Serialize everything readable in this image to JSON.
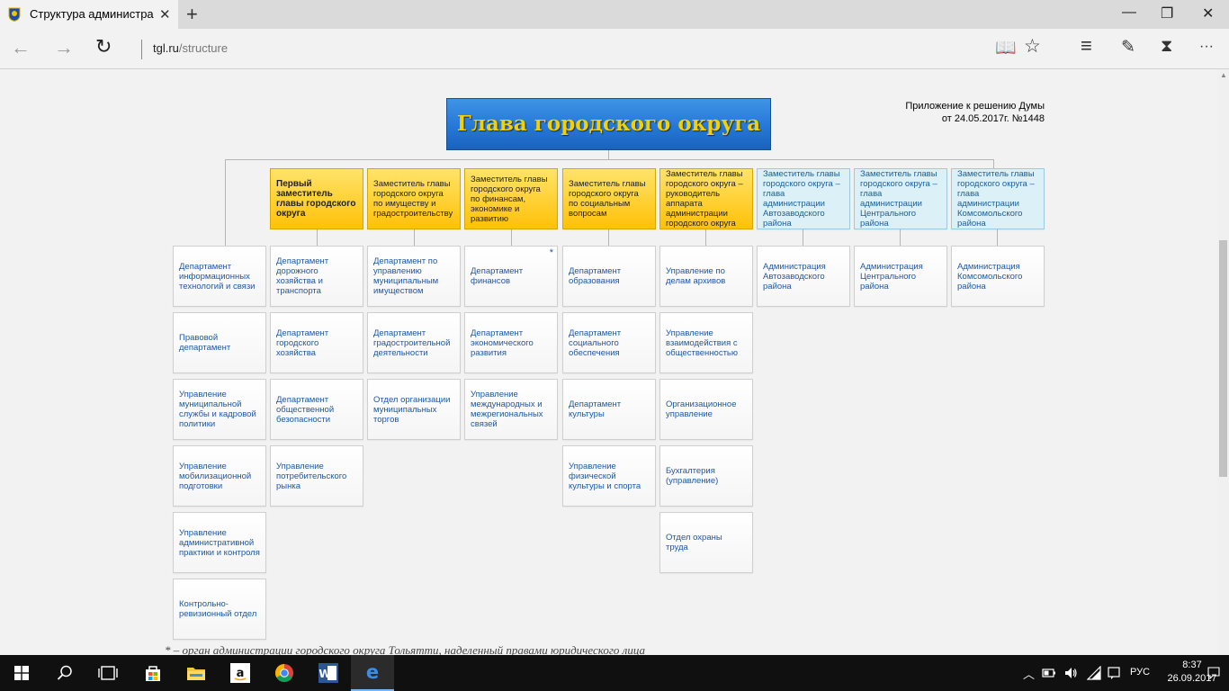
{
  "browser": {
    "tab_title": "Структура администра",
    "close_tab": "✕",
    "new_tab": "+",
    "url_host": "tgl.ru",
    "url_path": "/structure",
    "nav_back": "←",
    "nav_forward": "→",
    "refresh": "↻",
    "minimize": "—",
    "maximize": "❐",
    "close": "✕",
    "tools": {
      "reading": "📖",
      "favorite": "☆",
      "hub": "≡",
      "note": "✎",
      "share": "⧗",
      "more": "···"
    }
  },
  "page": {
    "head_title": "Глава городского округа",
    "note_line1": "Приложение к решению Думы",
    "note_line2": "от 24.05.2017г. №1448",
    "footnote": "* – орган администрации городского округа Тольятти, наделенный правами юридического лица",
    "deputies": [
      "Первый заместитель главы городского округа",
      "Заместитель главы городского округа по имуществу и градостроительству",
      "Заместитель главы городского округа по финансам, экономике и развитию",
      "Заместитель главы городского округа по социальным вопросам",
      "Заместитель главы городского округа – руководитель аппарата администрации городского округа",
      "Заместитель главы городского округа – глава администрации Автозаводского района",
      "Заместитель главы городского округа – глава администрации Центрального района",
      "Заместитель главы городского округа – глава администрации Комсомольского района"
    ],
    "columns": [
      [
        "Департамент информационных технологий и связи",
        "Правовой департамент",
        "Управление муниципальной службы и кадровой политики",
        "Управление мобилизационной подготовки",
        "Управление административной практики и контроля",
        "Контрольно-ревизионный отдел"
      ],
      [
        "Департамент дорожного хозяйства и транспорта",
        "Департамент городского хозяйства",
        "Департамент общественной безопасности",
        "Управление потребительского рынка"
      ],
      [
        "Департамент по управлению муниципальным имуществом",
        "Департамент градостроительной деятельности",
        "Отдел организации муниципальных торгов"
      ],
      [
        "Департамент финансов",
        "Департамент экономического развития",
        "Управление международных и межрегиональных связей"
      ],
      [
        "Департамент образования",
        "Департамент социального обеспечения",
        "Департамент культуры",
        "Управление физической культуры и спорта"
      ],
      [
        "Управление по делам архивов",
        "Управление взаимодействия с общественностью",
        "Организационное управление",
        "Бухгалтерия (управление)",
        "Отдел охраны труда"
      ],
      [
        "Администрация Автозаводского района"
      ],
      [
        "Администрация Центрального района"
      ],
      [
        "Администрация Комсомольского района"
      ]
    ],
    "star_mark": "*"
  },
  "taskbar": {
    "time": "8:37",
    "date": "26.09.2017",
    "lang": "РУС"
  },
  "colors": {
    "head_bg": "#2578d6",
    "head_text": "#f5d000",
    "deputy_yellow": "#ffc107",
    "deputy_blue": "#dcf0f7",
    "link_blue": "#1f58a6"
  }
}
